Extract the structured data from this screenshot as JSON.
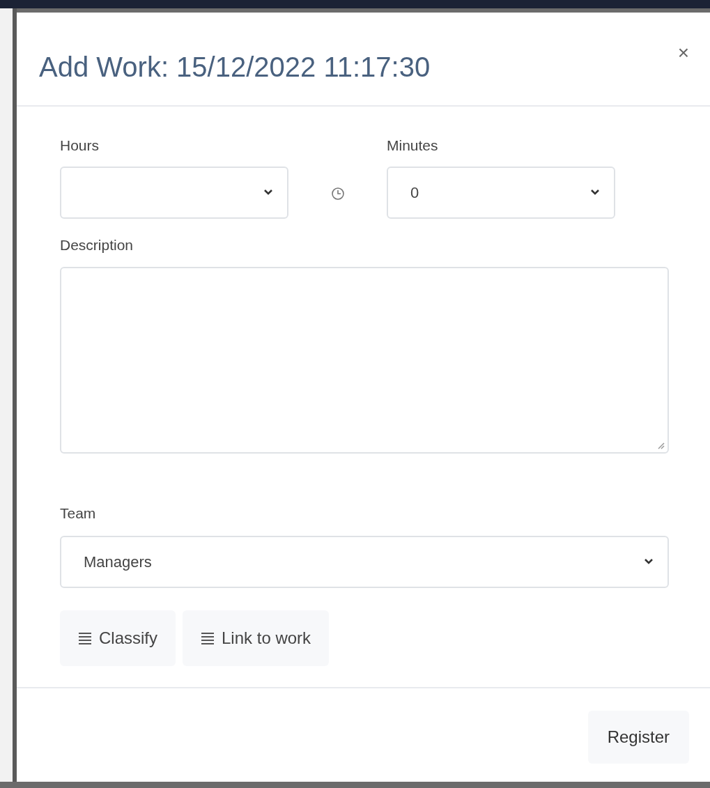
{
  "dialog": {
    "title": "Add Work: 15/12/2022 11:17:30",
    "close": "×"
  },
  "fields": [
    {
      "kind": "select",
      "label": "Hours"
    },
    {
      "kind": "select",
      "label": "Minutes",
      "value": "0"
    },
    {
      "kind": "textarea",
      "label": "Description"
    },
    {
      "kind": "select",
      "label": "Team",
      "value": "Managers"
    }
  ],
  "actions": [
    {
      "label": "Classify"
    },
    {
      "label": "Link to work"
    }
  ],
  "footer_buttons": [
    {
      "label": "Register"
    }
  ]
}
